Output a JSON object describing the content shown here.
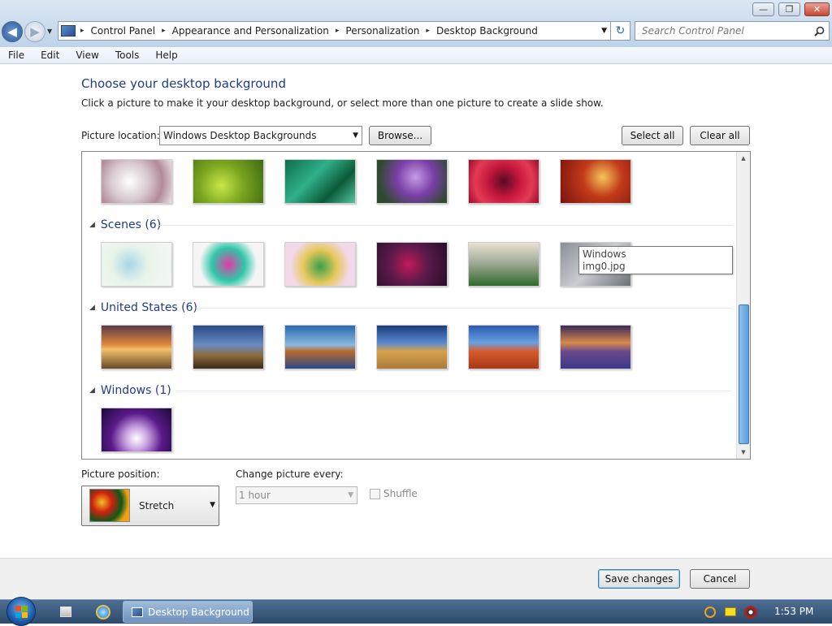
{
  "window": {
    "caption_minimize": "—",
    "caption_maximize": "❐",
    "caption_close": "✕"
  },
  "nav": {
    "back_glyph": "◀",
    "forward_glyph": "▶"
  },
  "address": {
    "crumbs": [
      "Control Panel",
      "Appearance and Personalization",
      "Personalization",
      "Desktop Background"
    ],
    "separator": "▸",
    "refresh_glyph": "↻"
  },
  "search": {
    "placeholder": "Search Control Panel"
  },
  "menu": {
    "items": [
      "File",
      "Edit",
      "View",
      "Tools",
      "Help"
    ]
  },
  "page": {
    "title": "Choose your desktop background",
    "subtitle": "Click a picture to make it your desktop background, or select more than one picture to create a slide show."
  },
  "location": {
    "label": "Picture location:",
    "value": "Windows Desktop Backgrounds",
    "browse_label": "Browse...",
    "select_all_label": "Select all",
    "clear_all_label": "Clear all"
  },
  "gallery": {
    "groups": [
      {
        "label": "Scenes (6)"
      },
      {
        "label": "United States (6)"
      },
      {
        "label": "Windows (1)"
      }
    ],
    "tooltip_line1": "Windows",
    "tooltip_line2": "img0.jpg"
  },
  "position": {
    "label": "Picture position:",
    "value": "Stretch"
  },
  "interval": {
    "label": "Change picture every:",
    "value": "1 hour",
    "shuffle_label": "Shuffle"
  },
  "footer": {
    "save_label": "Save changes",
    "cancel_label": "Cancel"
  },
  "taskbar": {
    "task_label": "Desktop Background",
    "clock": "1:53 PM"
  },
  "colors": {
    "accent": "#1e3c8a",
    "scroll_thumb": "#5c9ed8"
  }
}
